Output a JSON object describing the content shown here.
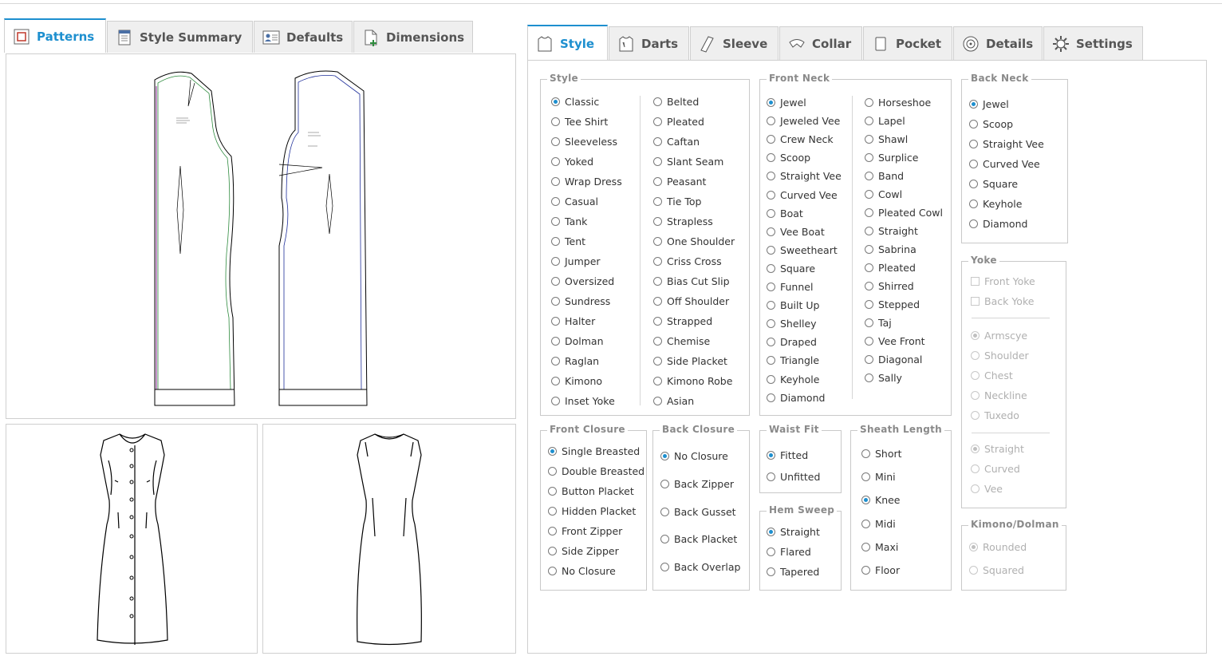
{
  "left_tabs": [
    {
      "label": "Patterns",
      "icon": "patterns-icon",
      "active": true
    },
    {
      "label": "Style Summary",
      "icon": "style-summary-icon",
      "active": false
    },
    {
      "label": "Defaults",
      "icon": "defaults-icon",
      "active": false
    },
    {
      "label": "Dimensions",
      "icon": "dimensions-icon",
      "active": false
    }
  ],
  "right_tabs": [
    {
      "label": "Style",
      "icon": "shirt-icon",
      "active": true
    },
    {
      "label": "Darts",
      "icon": "darts-icon",
      "active": false
    },
    {
      "label": "Sleeve",
      "icon": "sleeve-icon",
      "active": false
    },
    {
      "label": "Collar",
      "icon": "collar-icon",
      "active": false
    },
    {
      "label": "Pocket",
      "icon": "pocket-icon",
      "active": false
    },
    {
      "label": "Details",
      "icon": "details-icon",
      "active": false
    },
    {
      "label": "Settings",
      "icon": "gear-icon",
      "active": false
    }
  ],
  "style_group": {
    "title": "Style",
    "col1": [
      "Classic",
      "Tee Shirt",
      "Sleeveless",
      "Yoked",
      "Wrap Dress",
      "Casual",
      "Tank",
      "Tent",
      "Jumper",
      "Oversized",
      "Sundress",
      "Halter",
      "Dolman",
      "Raglan",
      "Kimono",
      "Inset Yoke"
    ],
    "col2": [
      "Belted",
      "Pleated",
      "Caftan",
      "Slant Seam",
      "Peasant",
      "Tie Top",
      "Strapless",
      "One Shoulder",
      "Criss Cross",
      "Bias Cut Slip",
      "Off Shoulder",
      "Strapped",
      "Chemise",
      "Side Placket",
      "Kimono Robe",
      "Asian"
    ],
    "selected": "Classic"
  },
  "front_neck_group": {
    "title": "Front Neck",
    "col1": [
      "Jewel",
      "Jeweled Vee",
      "Crew Neck",
      "Scoop",
      "Straight Vee",
      "Curved Vee",
      "Boat",
      "Vee Boat",
      "Sweetheart",
      "Square",
      "Funnel",
      "Built Up",
      "Shelley",
      "Draped",
      "Triangle",
      "Keyhole",
      "Diamond"
    ],
    "col2": [
      "Horseshoe",
      "Lapel",
      "Shawl",
      "Surplice",
      "Band",
      "Cowl",
      "Pleated Cowl",
      "Straight",
      "Sabrina",
      "Pleated",
      "Shirred",
      "Stepped",
      "Taj",
      "Vee Front",
      "Diagonal",
      "Sally"
    ],
    "selected": "Jewel"
  },
  "back_neck_group": {
    "title": "Back Neck",
    "options": [
      "Jewel",
      "Scoop",
      "Straight Vee",
      "Curved Vee",
      "Square",
      "Keyhole",
      "Diamond"
    ],
    "selected": "Jewel"
  },
  "yoke_group": {
    "title": "Yoke",
    "checks": [
      "Front Yoke",
      "Back Yoke"
    ],
    "radios1": [
      "Armscye",
      "Shoulder",
      "Chest",
      "Neckline",
      "Tuxedo"
    ],
    "selected1": "Armscye",
    "radios2": [
      "Straight",
      "Curved",
      "Vee"
    ],
    "selected2": "Straight"
  },
  "kimono_group": {
    "title": "Kimono/Dolman",
    "options": [
      "Rounded",
      "Squared"
    ],
    "selected": "Rounded"
  },
  "front_closure_group": {
    "title": "Front Closure",
    "options": [
      "Single Breasted",
      "Double Breasted",
      "Button Placket",
      "Hidden Placket",
      "Front Zipper",
      "Side Zipper",
      "No Closure"
    ],
    "selected": "Single Breasted"
  },
  "back_closure_group": {
    "title": "Back Closure",
    "options": [
      "No Closure",
      "Back Zipper",
      "Back Gusset",
      "Back Placket",
      "Back Overlap"
    ],
    "selected": "No Closure"
  },
  "waist_fit_group": {
    "title": "Waist Fit",
    "options": [
      "Fitted",
      "Unfitted"
    ],
    "selected": "Fitted"
  },
  "hem_sweep_group": {
    "title": "Hem Sweep",
    "options": [
      "Straight",
      "Flared",
      "Tapered"
    ],
    "selected": "Straight"
  },
  "sheath_length_group": {
    "title": "Sheath Length",
    "options": [
      "Short",
      "Mini",
      "Knee",
      "Midi",
      "Maxi",
      "Floor"
    ],
    "selected": "Knee"
  }
}
